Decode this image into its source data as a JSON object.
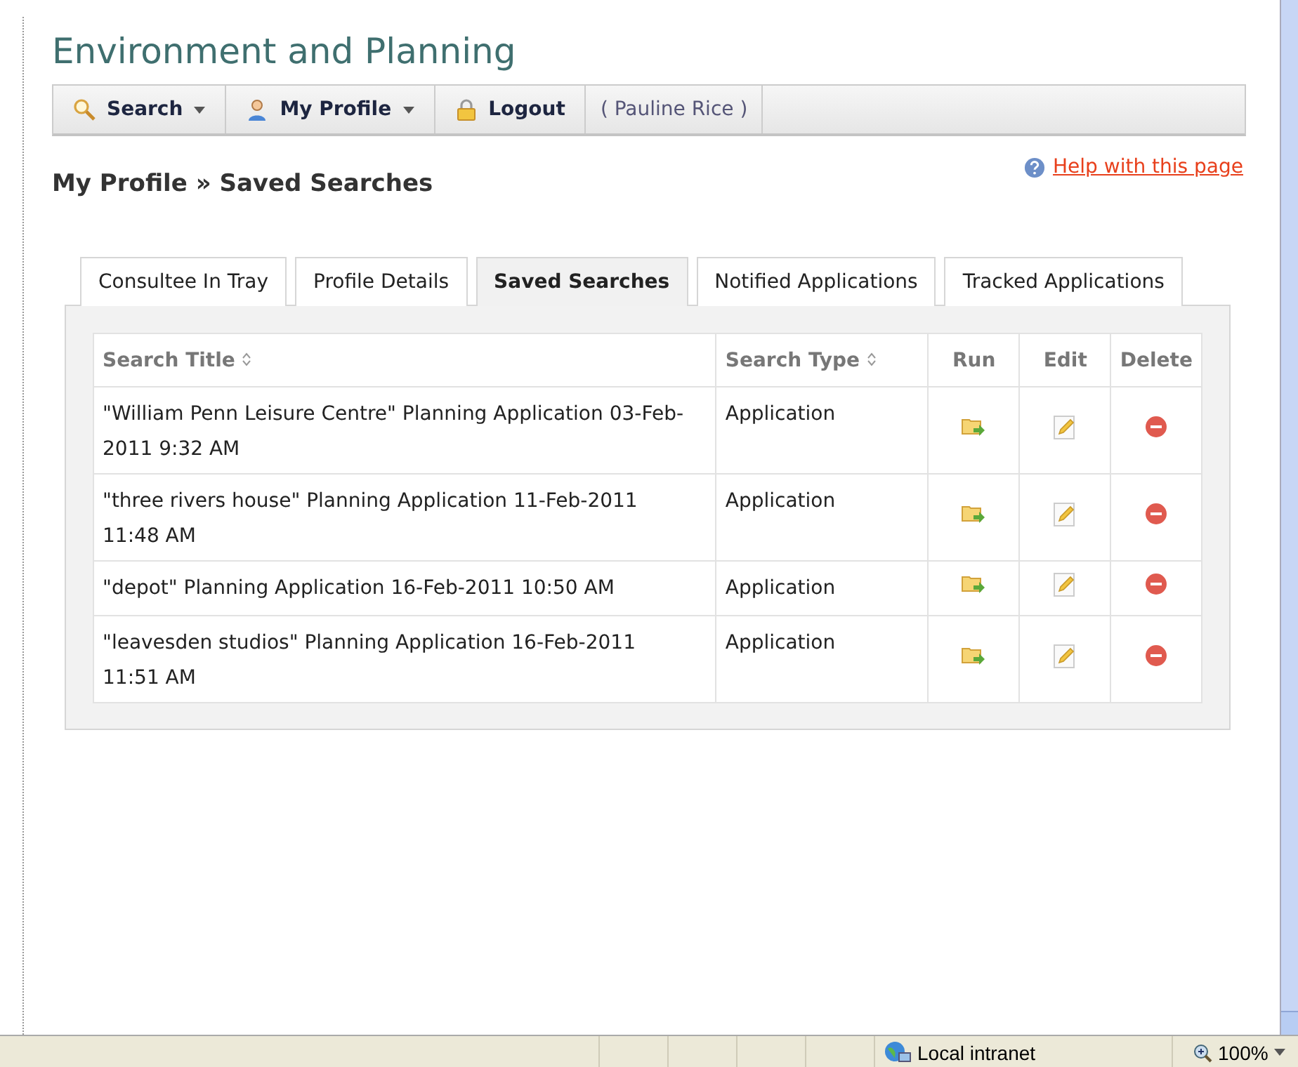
{
  "page_title": "Environment and Planning",
  "menu": [
    {
      "kind": "search",
      "label": "Search",
      "dropdown": true
    },
    {
      "kind": "profile",
      "label": "My Profile",
      "dropdown": true
    },
    {
      "kind": "logout",
      "label": "Logout",
      "dropdown": false
    },
    {
      "kind": "user",
      "label": "( Pauline Rice )",
      "dropdown": false
    }
  ],
  "breadcrumb": "My Profile » Saved Searches",
  "help_link": "Help with this page",
  "tabs": [
    {
      "label": "Consultee In Tray",
      "selected": false
    },
    {
      "label": "Profile Details",
      "selected": false
    },
    {
      "label": "Saved Searches",
      "selected": true
    },
    {
      "label": "Notified Applications",
      "selected": false
    },
    {
      "label": "Tracked Applications",
      "selected": false
    }
  ],
  "table": {
    "columns": [
      {
        "label": "Search Title",
        "sortable": true
      },
      {
        "label": "Search Type",
        "sortable": true
      },
      {
        "label": "Run",
        "sortable": false
      },
      {
        "label": "Edit",
        "sortable": false
      },
      {
        "label": "Delete",
        "sortable": false
      }
    ],
    "rows": [
      {
        "title": "\"William Penn Leisure Centre\" Planning Application 03-Feb-2011 9:32 AM",
        "type": "Application"
      },
      {
        "title": "\"three rivers house\" Planning Application 11-Feb-2011 11:48 AM",
        "type": "Application"
      },
      {
        "title": "\"depot\" Planning Application 16-Feb-2011 10:50 AM",
        "type": "Application"
      },
      {
        "title": "\"leavesden studios\" Planning Application 16-Feb-2011 11:51 AM",
        "type": "Application"
      }
    ]
  },
  "status_bar": {
    "zone": "Local intranet",
    "zoom": "100%"
  }
}
